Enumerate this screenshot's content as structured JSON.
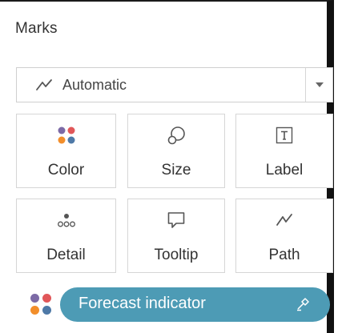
{
  "panel": {
    "title": "Marks"
  },
  "mark_type": {
    "selected": "Automatic",
    "icon": "line-chart-icon"
  },
  "mark_cards": [
    {
      "label": "Color",
      "icon": "color-dots-icon"
    },
    {
      "label": "Size",
      "icon": "size-circles-icon"
    },
    {
      "label": "Label",
      "icon": "text-label-icon"
    },
    {
      "label": "Detail",
      "icon": "detail-dots-icon"
    },
    {
      "label": "Tooltip",
      "icon": "tooltip-bubble-icon"
    },
    {
      "label": "Path",
      "icon": "path-line-icon"
    }
  ],
  "field_pill": {
    "label": "Forecast indicator",
    "encoding_icon": "color-dots-icon",
    "action_icon": "highlight-icon"
  },
  "colors": {
    "pill": "#4d9bb5",
    "dot_purple": "#7c6aa6",
    "dot_red": "#e15759",
    "dot_orange": "#f28e2b",
    "dot_blue": "#4e79a7"
  }
}
